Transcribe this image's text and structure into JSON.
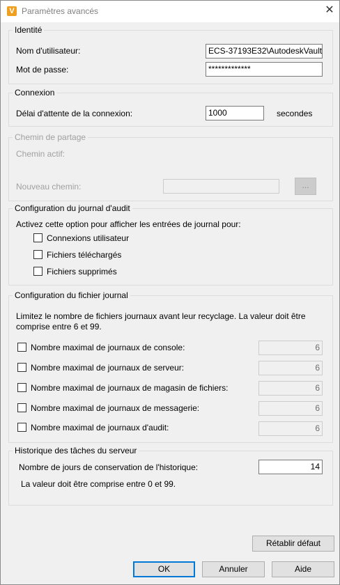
{
  "window": {
    "title": "Paramètres avancés",
    "app_icon_letter": "V",
    "close_icon": "close-icon"
  },
  "identity": {
    "legend": "Identité",
    "username_label": "Nom d'utilisateur:",
    "username_value": "ECS-37193E32\\AutodeskVault",
    "password_label": "Mot de passe:",
    "password_value": "*************"
  },
  "connection": {
    "legend": "Connexion",
    "timeout_label": "Délai d'attente de la connexion:",
    "timeout_value": "1000",
    "timeout_unit": "secondes"
  },
  "share_path": {
    "legend": "Chemin de partage",
    "active_label": "Chemin actif:",
    "new_label": "Nouveau chemin:",
    "new_value": "",
    "browse_label": "..."
  },
  "audit": {
    "legend": "Configuration du journal d'audit",
    "description": "Activez cette option pour afficher les entrées de journal pour:",
    "options": [
      {
        "label": "Connexions utilisateur",
        "checked": false
      },
      {
        "label": "Fichiers téléchargés",
        "checked": false
      },
      {
        "label": "Fichiers supprimés",
        "checked": false
      }
    ]
  },
  "log_file": {
    "legend": "Configuration du fichier journal",
    "description_line1": "Limitez le nombre de fichiers journaux avant leur recyclage. La valeur doit être",
    "description_line2": "comprise entre 6 et 99.",
    "rows": [
      {
        "label": "Nombre maximal de journaux de console:",
        "value": "6",
        "checked": false
      },
      {
        "label": "Nombre maximal de journaux de serveur:",
        "value": "6",
        "checked": false
      },
      {
        "label": "Nombre maximal de journaux de magasin de fichiers:",
        "value": "6",
        "checked": false
      },
      {
        "label": "Nombre maximal de journaux de messagerie:",
        "value": "6",
        "checked": false
      },
      {
        "label": "Nombre maximal de journaux d'audit:",
        "value": "6",
        "checked": false
      }
    ]
  },
  "history": {
    "legend": "Historique des tâches du serveur",
    "days_label": "Nombre de jours de conservation de l'historique:",
    "days_value": "14",
    "hint": "La valeur doit être comprise entre 0 et 99."
  },
  "buttons": {
    "restore": "Rétablir défaut",
    "ok": "OK",
    "cancel": "Annuler",
    "help": "Aide"
  }
}
